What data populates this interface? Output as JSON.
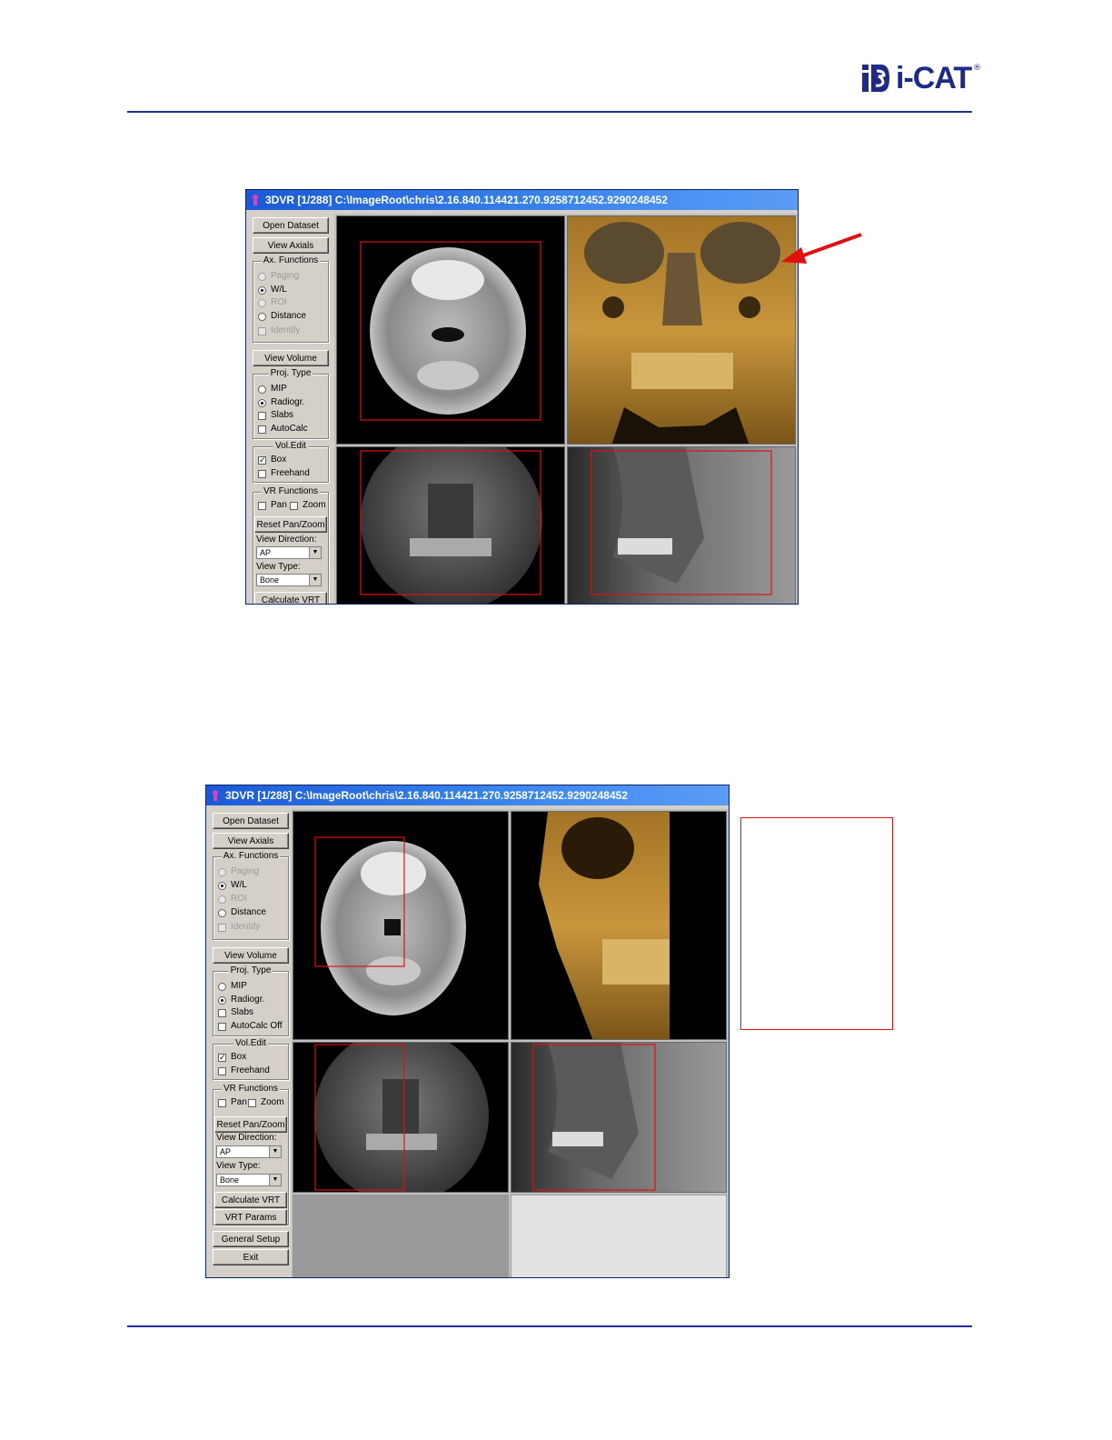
{
  "header": {
    "logo_text": "i-CAT",
    "logo_mark": "iS"
  },
  "window_top": {
    "title": "3DVR [1/288] C:\\ImageRoot\\chris\\2.16.840.114421.270.9258712452.9290248452",
    "buttons": {
      "open_dataset": "Open Dataset",
      "view_axials": "View Axials",
      "view_volume": "View Volume",
      "reset_pan_zoom": "Reset Pan/Zoom",
      "calculate_vrt": "Calculate VRT"
    },
    "ax_functions": {
      "title": "Ax. Functions",
      "paging": "Paging",
      "wl": "W/L",
      "roi": "ROI",
      "distance": "Distance",
      "identify": "Identify"
    },
    "proj_type": {
      "title": "Proj. Type",
      "mip": "MIP",
      "radiogr": "Radiogr.",
      "slabs": "Slabs",
      "autocalc": "AutoCalc"
    },
    "vol_edit": {
      "title": "Vol.Edit",
      "box": "Box",
      "freehand": "Freehand"
    },
    "vr_functions": {
      "title": "VR Functions",
      "pan": "Pan",
      "zoom": "Zoom"
    },
    "view_direction": {
      "label": "View Direction:",
      "value": "AP"
    },
    "view_type": {
      "label": "View Type:",
      "value": "Bone"
    }
  },
  "window_bottom": {
    "title": "3DVR [1/288] C:\\ImageRoot\\chris\\2.16.840.114421.270.9258712452.9290248452",
    "buttons": {
      "open_dataset": "Open Dataset",
      "view_axials": "View Axials",
      "view_volume": "View Volume",
      "reset_pan_zoom": "Reset Pan/Zoom",
      "calculate_vrt": "Calculate VRT",
      "vrt_params": "VRT Params",
      "general_setup": "General Setup",
      "exit": "Exit"
    },
    "ax_functions": {
      "title": "Ax. Functions",
      "paging": "Paging",
      "wl": "W/L",
      "roi": "ROI",
      "distance": "Distance",
      "identify": "Identify"
    },
    "proj_type": {
      "title": "Proj. Type",
      "mip": "MIP",
      "radiogr": "Radiogr.",
      "slabs": "Slabs",
      "autocalc": "AutoCalc Off"
    },
    "vol_edit": {
      "title": "Vol.Edit",
      "box": "Box",
      "freehand": "Freehand"
    },
    "vr_functions": {
      "title": "VR Functions",
      "pan": "Pan",
      "zoom": "Zoom"
    },
    "view_direction": {
      "label": "View Direction:",
      "value": "AP"
    },
    "view_type": {
      "label": "View Type:",
      "value": "Bone"
    }
  },
  "colors": {
    "rule": "#1f2e9c",
    "title_bar": "#1a5ad8",
    "callout": "#e01010",
    "bone": "#b8862e"
  }
}
